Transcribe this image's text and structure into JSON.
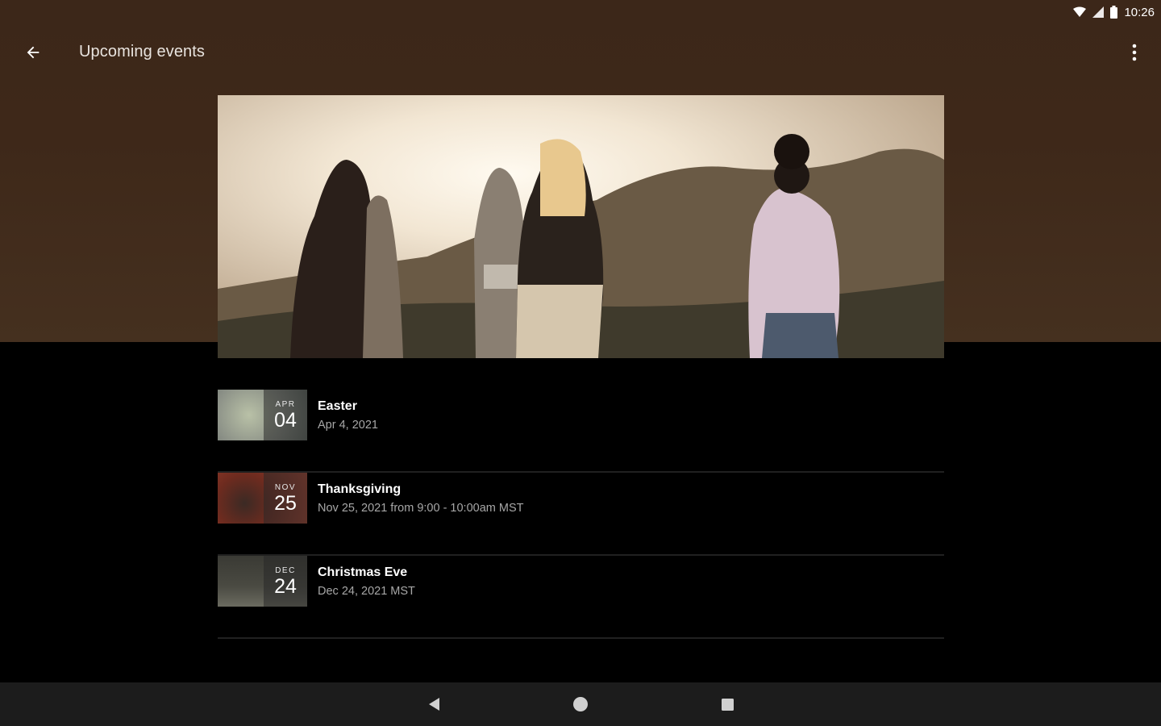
{
  "status": {
    "time": "10:26",
    "icons": [
      "wifi-icon",
      "signal-icon",
      "battery-icon"
    ]
  },
  "app_bar": {
    "title": "Upcoming events",
    "back_icon": "arrow-back-icon",
    "menu_icon": "more-vert-icon"
  },
  "hero": {
    "image": "group-of-friends-at-sunset-photo"
  },
  "events": [
    {
      "title": "Easter",
      "date": "Apr 4, 2021",
      "month": "APR",
      "day": "04",
      "thumb_color": "#8a8f86"
    },
    {
      "title": "Thanksgiving",
      "date": "Nov 25, 2021 from 9:00 - 10:00am MST",
      "month": "NOV",
      "day": "25",
      "thumb_color": "#a8412e"
    },
    {
      "title": "Christmas Eve",
      "date": "Dec 24, 2021 MST",
      "month": "DEC",
      "day": "24",
      "thumb_color": "#4a4a42"
    }
  ],
  "nav_bar": {
    "icons": [
      "nav-back-icon",
      "nav-home-icon",
      "nav-recents-icon"
    ]
  },
  "colors": {
    "header_bg": "#3e2819",
    "list_bg": "#000000",
    "nav_bg": "#1c1c1c",
    "divider": "#202020",
    "secondary_text": "#a7a7a7"
  }
}
